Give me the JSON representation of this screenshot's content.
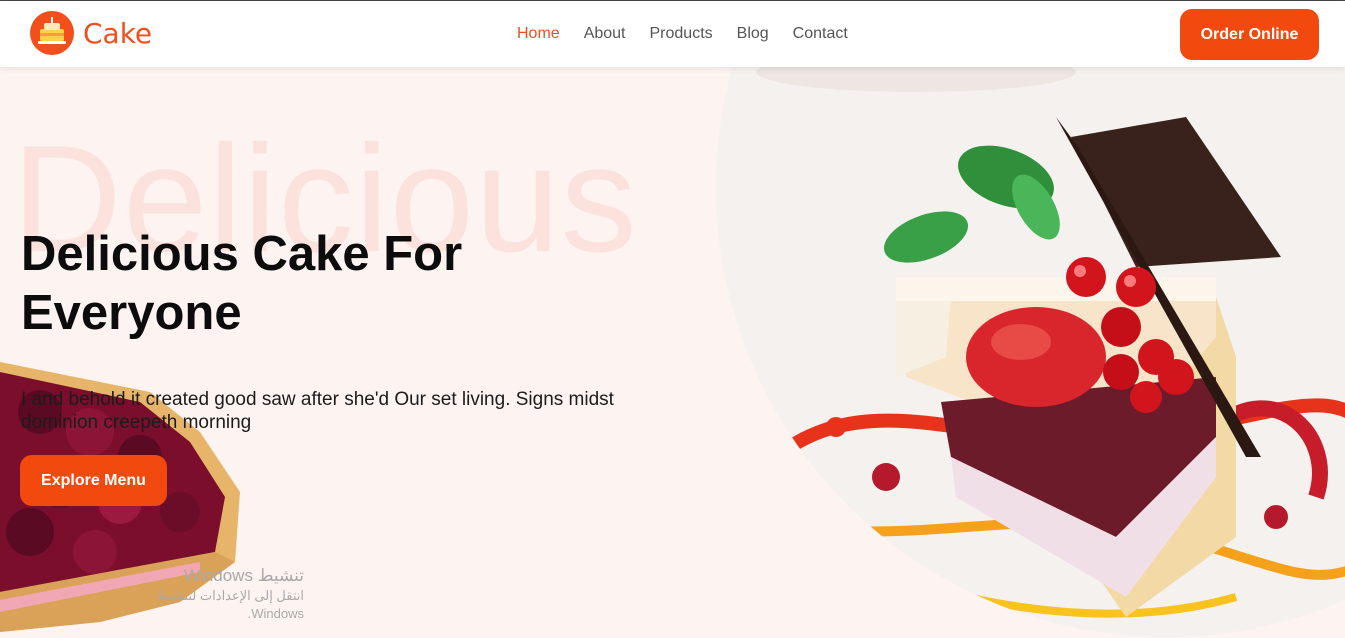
{
  "brand": {
    "name": "Cake",
    "icon": "cake-logo-icon",
    "accent": "#f24a0e"
  },
  "nav": {
    "items": [
      {
        "label": "Home",
        "active": true
      },
      {
        "label": "About"
      },
      {
        "label": "Products"
      },
      {
        "label": "Blog"
      },
      {
        "label": "Contact"
      }
    ]
  },
  "header": {
    "cta_label": "Order Online"
  },
  "hero": {
    "background_word": "Delicious",
    "title": "Delicious Cake For Everyone",
    "description": "I and behold it created good saw after she'd Our set living. Signs midst dominion creepeth morning",
    "cta_label": "Explore Menu",
    "images": [
      "cake-slice-photo",
      "berry-tart-photo"
    ]
  },
  "windows_watermark": {
    "title": "تنشيط Windows",
    "subtitle": "انتقل إلى الإعدادات لتنشيط Windows."
  }
}
